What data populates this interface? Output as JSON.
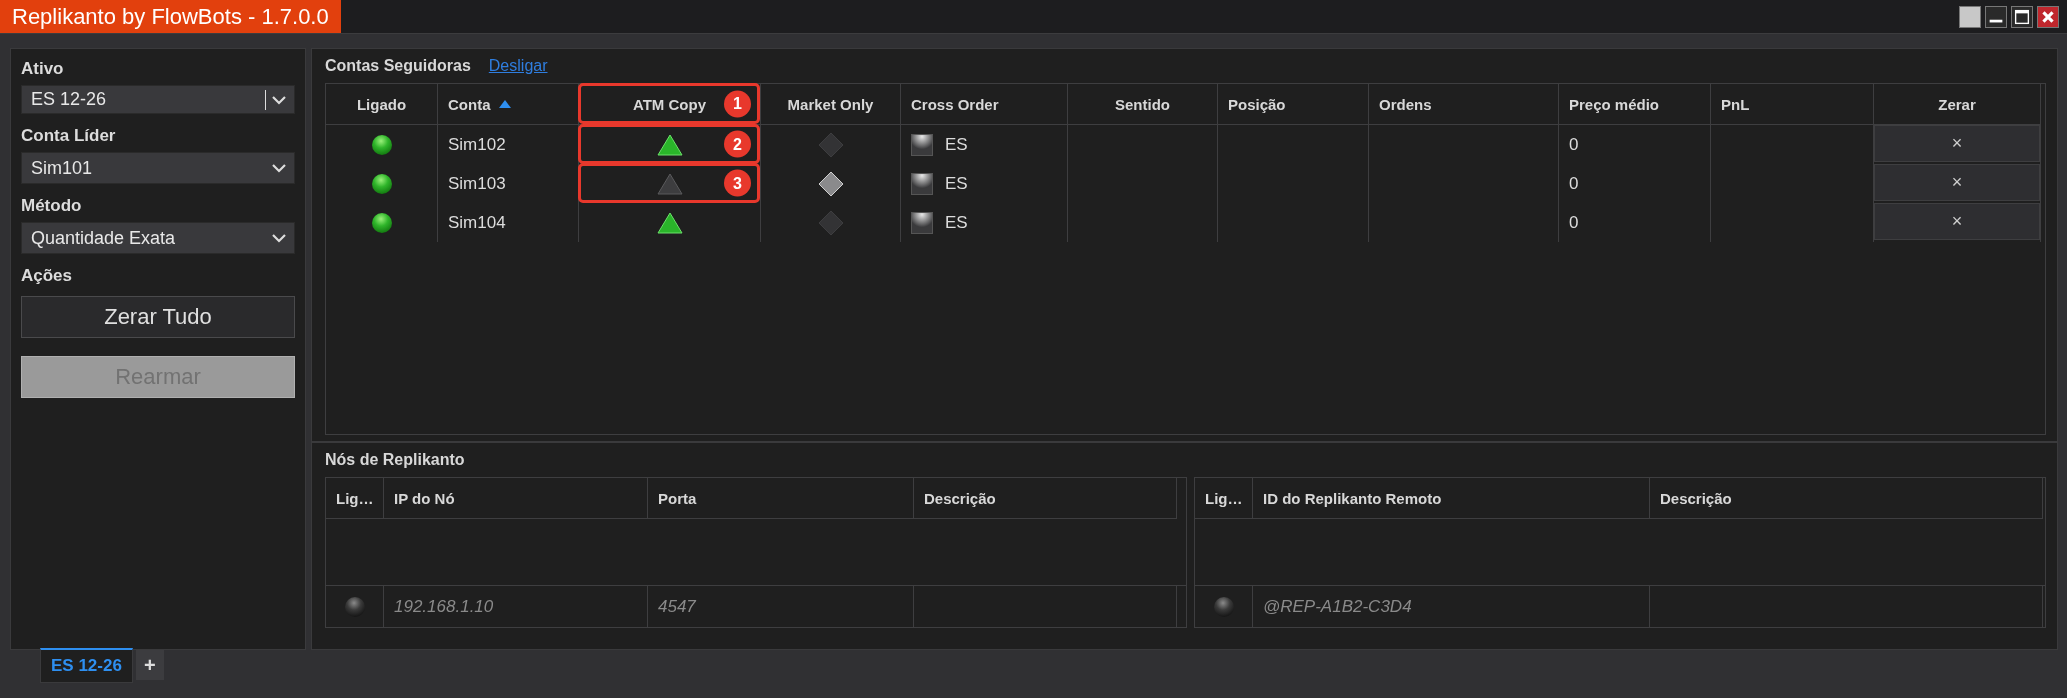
{
  "window": {
    "title": "Replikanto by FlowBots - 1.7.0.0"
  },
  "sidebar": {
    "fields": [
      {
        "label": "Ativo",
        "value": "ES 12-26",
        "kind": "combo"
      },
      {
        "label": "Conta Líder",
        "value": "Sim101",
        "kind": "dropdown"
      },
      {
        "label": "Método",
        "value": "Quantidade Exata",
        "kind": "dropdown"
      }
    ],
    "actions_label": "Ações",
    "buttons": [
      {
        "label": "Zerar Tudo",
        "disabled": false
      },
      {
        "label": "Rearmar",
        "disabled": true
      }
    ]
  },
  "followers": {
    "title": "Contas Seguidoras",
    "link": "Desligar",
    "columns": [
      {
        "label": "Ligado",
        "sorted": false
      },
      {
        "label": "Conta",
        "sorted": true
      },
      {
        "label": "ATM Copy",
        "sorted": false,
        "callout": "1"
      },
      {
        "label": "Market Only",
        "sorted": false
      },
      {
        "label": "Cross Order",
        "sorted": false
      },
      {
        "label": "Sentido",
        "sorted": false
      },
      {
        "label": "Posição",
        "sorted": false
      },
      {
        "label": "Ordens",
        "sorted": false
      },
      {
        "label": "Preço médio",
        "sorted": false
      },
      {
        "label": "PnL",
        "sorted": false
      },
      {
        "label": "Zerar",
        "sorted": false
      }
    ],
    "rows": [
      {
        "connected": true,
        "account": "Sim102",
        "atm_copy": true,
        "atm_callout": "2",
        "market_only": false,
        "cross_order": "ES",
        "avg_price": "0",
        "reset": "×"
      },
      {
        "connected": true,
        "account": "Sim103",
        "atm_copy": false,
        "atm_callout": "3",
        "market_only": true,
        "cross_order": "ES",
        "avg_price": "0",
        "reset": "×"
      },
      {
        "connected": true,
        "account": "Sim104",
        "atm_copy": true,
        "market_only": false,
        "cross_order": "ES",
        "avg_price": "0",
        "reset": "×"
      }
    ]
  },
  "nodes": {
    "title": "Nós de Replikanto",
    "tables": [
      {
        "columns": [
          "Lig…",
          "IP do Nó",
          "Porta",
          "Descrição"
        ],
        "rows": [
          {
            "connected": false,
            "cells": [
              "",
              "192.168.1.10",
              "4547"
            ]
          }
        ]
      },
      {
        "columns": [
          "Lig…",
          "ID do Replikanto Remoto",
          "Descrição"
        ],
        "rows": [
          {
            "connected": false,
            "cells": [
              "",
              "@REP-A1B2-C3D4"
            ]
          }
        ]
      }
    ]
  },
  "bottom_tabs": {
    "tabs": [
      {
        "label": "ES 12-26",
        "selected": true
      }
    ],
    "add": "+"
  }
}
